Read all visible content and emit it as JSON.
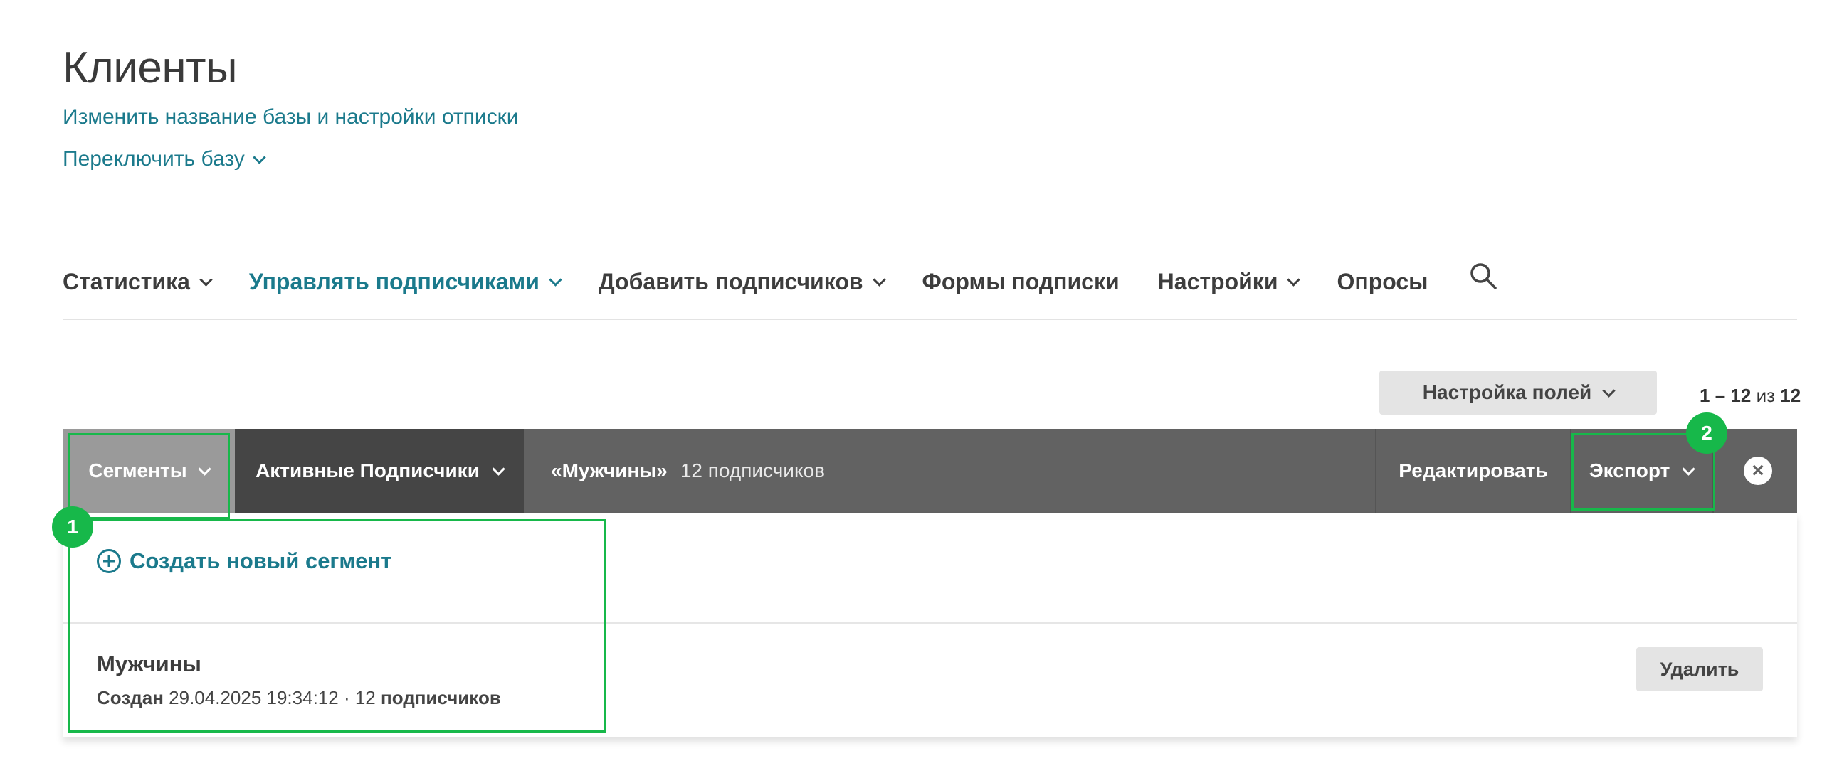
{
  "header": {
    "title": "Клиенты",
    "rename_link": "Изменить название базы и настройки отписки",
    "switch_link": "Переключить базу"
  },
  "nav": {
    "items": [
      {
        "label": "Статистика"
      },
      {
        "label": "Управлять подписчиками"
      },
      {
        "label": "Добавить подписчиков"
      },
      {
        "label": "Формы подписки"
      },
      {
        "label": "Настройки"
      },
      {
        "label": "Опросы"
      }
    ],
    "active_index": 1
  },
  "fields_button": {
    "label": "Настройка полей"
  },
  "pager": {
    "from": "1",
    "dash": "–",
    "to": "12",
    "of": "из",
    "total": "12"
  },
  "toolbar": {
    "segments_label": "Сегменты",
    "active_filter_label": "Активные Подписчики",
    "current_segment": "«Мужчины»",
    "current_count": "12 подписчиков",
    "edit_label": "Редактировать",
    "export_label": "Экспорт",
    "close_symbol": "×"
  },
  "dropdown": {
    "create_label": "Создать новый сегмент",
    "segment": {
      "name": "Мужчины",
      "created_label": "Создан",
      "created_value": "29.04.2025 19:34:12 · 12",
      "subscribers_label": "подписчиков",
      "delete_label": "Удалить"
    }
  },
  "annotations": {
    "badge1": "1",
    "badge2": "2"
  },
  "colors": {
    "accent": "#1b7a8c",
    "highlight": "#17b84a",
    "toolbar": "#626262"
  }
}
